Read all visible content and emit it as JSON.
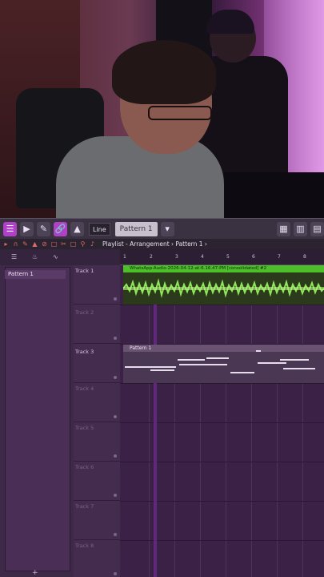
{
  "toolbar": {
    "snap_label": "Line",
    "pattern_label": "Pattern 1"
  },
  "playlist": {
    "title": "Playlist - Arrangement › Pattern 1 ›"
  },
  "picker": {
    "items": [
      "Pattern 1"
    ],
    "add_label": "+"
  },
  "ruler": {
    "bars": [
      "1",
      "2",
      "3",
      "4",
      "5",
      "6",
      "7",
      "8"
    ]
  },
  "tracks": [
    {
      "label": "Track 1"
    },
    {
      "label": "Track 2"
    },
    {
      "label": "Track 3"
    },
    {
      "label": "Track 4"
    },
    {
      "label": "Track 5"
    },
    {
      "label": "Track 6"
    },
    {
      "label": "Track 7"
    },
    {
      "label": "Track 8"
    }
  ],
  "clips": {
    "audio_name": "WhatsApp-Audio-2026-04-12-at-6.16.47-PM [consolidated] #2",
    "pattern_name": "Pattern 1"
  },
  "colors": {
    "accent": "#b040c8",
    "audio_clip": "#4cbf2a",
    "grid_bg": "#3b2146"
  }
}
